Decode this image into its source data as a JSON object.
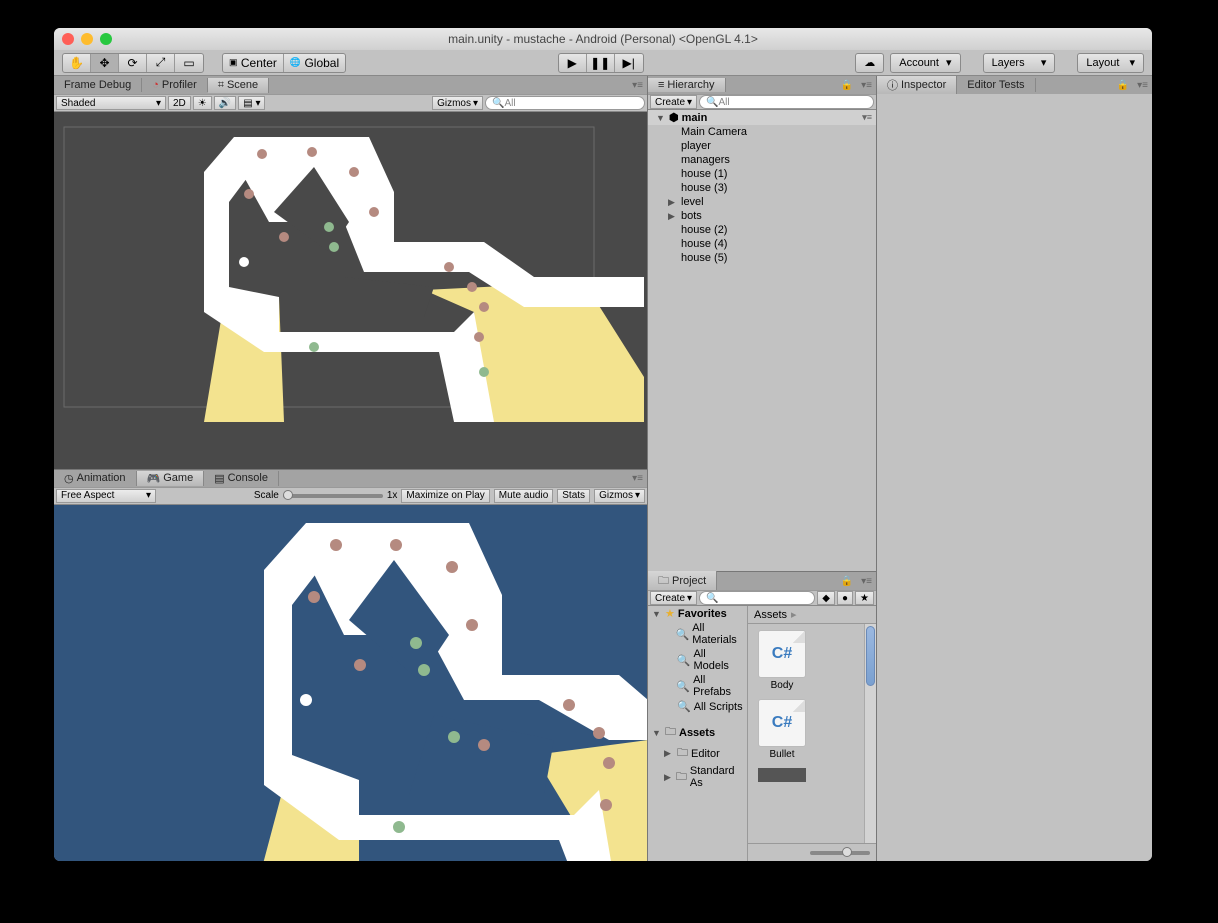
{
  "title": "main.unity - mustache - Android (Personal) <OpenGL 4.1>",
  "toolbar": {
    "center": "Center",
    "global": "Global",
    "account": "Account",
    "layers": "Layers",
    "layout": "Layout"
  },
  "sceneTabs": {
    "frameDebug": "Frame Debug",
    "profiler": "Profiler",
    "scene": "Scene"
  },
  "sceneToolbar": {
    "shaded": "Shaded",
    "twod": "2D",
    "gizmos": "Gizmos",
    "searchPlaceholder": "All"
  },
  "gameTabs": {
    "animation": "Animation",
    "game": "Game",
    "console": "Console"
  },
  "gameToolbar": {
    "freeAspect": "Free Aspect",
    "scale": "Scale",
    "scaleVal": "1x",
    "maxPlay": "Maximize on Play",
    "mute": "Mute audio",
    "stats": "Stats",
    "gizmos": "Gizmos"
  },
  "hierarchy": {
    "title": "Hierarchy",
    "create": "Create",
    "searchPlaceholder": "All",
    "scene": "main",
    "items": [
      "Main Camera",
      "player",
      "managers",
      "house (1)",
      "house (3)",
      "level",
      "bots",
      "house (2)",
      "house (4)",
      "house (5)"
    ]
  },
  "project": {
    "title": "Project",
    "create": "Create",
    "favorites": "Favorites",
    "favItems": [
      "All Materials",
      "All Models",
      "All Prefabs",
      "All Scripts"
    ],
    "assets": "Assets",
    "folders": [
      "Editor",
      "Standard As"
    ],
    "breadcrumb": "Assets",
    "files": [
      "Body",
      "Bullet"
    ]
  },
  "inspector": {
    "title": "Inspector",
    "editorTests": "Editor Tests"
  }
}
